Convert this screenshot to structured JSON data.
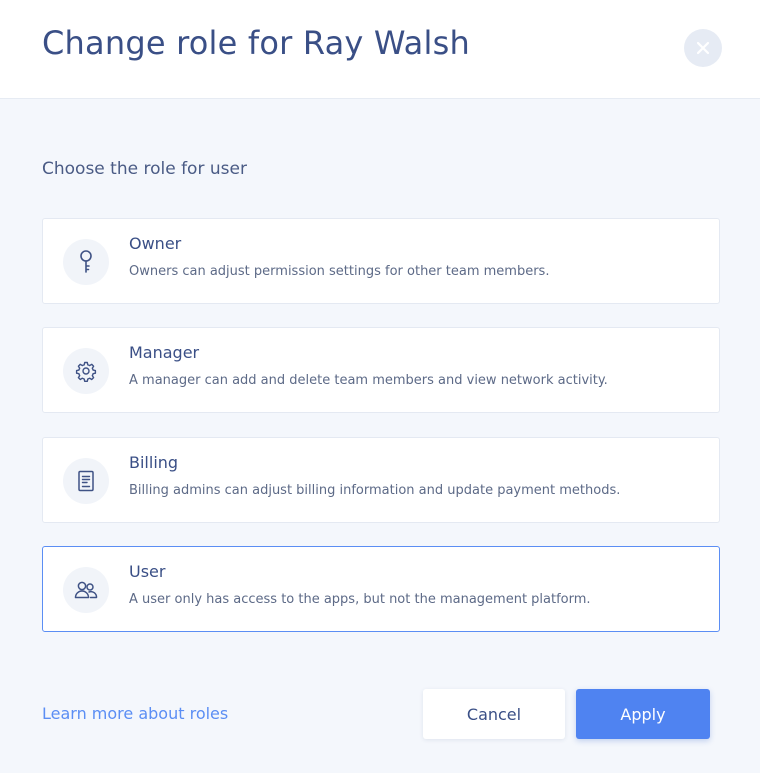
{
  "dialog": {
    "title": "Change role for Ray Walsh",
    "close_icon": "close-icon",
    "prompt": "Choose the role for user"
  },
  "roles": [
    {
      "id": "owner",
      "name": "Owner",
      "description": "Owners can adjust permission settings for other team members.",
      "icon": "key-icon",
      "selected": false
    },
    {
      "id": "manager",
      "name": "Manager",
      "description": "A manager can add and delete team members and view network activity.",
      "icon": "gear-icon",
      "selected": false
    },
    {
      "id": "billing",
      "name": "Billing",
      "description": "Billing admins can adjust billing information and update payment methods.",
      "icon": "receipt-icon",
      "selected": false
    },
    {
      "id": "user",
      "name": "User",
      "description": "A user only has access to the apps, but not the management platform.",
      "icon": "users-icon",
      "selected": true
    }
  ],
  "footer": {
    "learn_more": "Learn more about roles",
    "cancel_label": "Cancel",
    "apply_label": "Apply"
  },
  "colors": {
    "accent": "#4f83f1",
    "title": "#3a4f86",
    "selected_border": "#5b8ef4",
    "background": "#f4f7fc"
  }
}
